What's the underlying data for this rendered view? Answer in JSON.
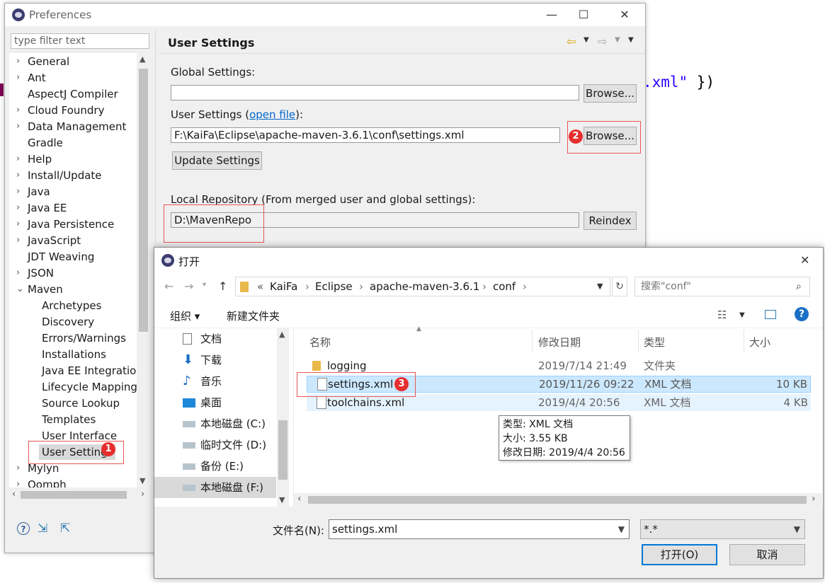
{
  "background_editor": {
    "code_fragment": "t.xml\" })"
  },
  "preferences": {
    "title": "Preferences",
    "filter_placeholder": "type filter text",
    "tree": [
      {
        "label": "General",
        "expandable": true
      },
      {
        "label": "Ant",
        "expandable": true
      },
      {
        "label": "AspectJ Compiler",
        "expandable": false
      },
      {
        "label": "Cloud Foundry",
        "expandable": true
      },
      {
        "label": "Data Management",
        "expandable": true
      },
      {
        "label": "Gradle",
        "expandable": false
      },
      {
        "label": "Help",
        "expandable": true
      },
      {
        "label": "Install/Update",
        "expandable": true
      },
      {
        "label": "Java",
        "expandable": true
      },
      {
        "label": "Java EE",
        "expandable": true
      },
      {
        "label": "Java Persistence",
        "expandable": true
      },
      {
        "label": "JavaScript",
        "expandable": true
      },
      {
        "label": "JDT Weaving",
        "expandable": false
      },
      {
        "label": "JSON",
        "expandable": true
      },
      {
        "label": "Maven",
        "expanded": true
      },
      {
        "label": "Archetypes",
        "child": true
      },
      {
        "label": "Discovery",
        "child": true
      },
      {
        "label": "Errors/Warnings",
        "child": true
      },
      {
        "label": "Installations",
        "child": true
      },
      {
        "label": "Java EE Integration",
        "child": true
      },
      {
        "label": "Lifecycle Mapping",
        "child": true
      },
      {
        "label": "Source Lookup",
        "child": true
      },
      {
        "label": "Templates",
        "child": true
      },
      {
        "label": "User Interface",
        "child": true
      },
      {
        "label": "User Settings",
        "child": true,
        "selected": true
      },
      {
        "label": "Mylyn",
        "expandable": true
      },
      {
        "label": "Oomph",
        "expandable": true
      }
    ],
    "page_title": "User Settings",
    "global_settings_label": "Global Settings:",
    "global_settings_value": "",
    "user_settings_label_prefix": "User Settings (",
    "user_settings_link": "open file",
    "user_settings_label_suffix": "):",
    "user_settings_value": "F:\\KaiFa\\Eclipse\\apache-maven-3.6.1\\conf\\settings.xml",
    "browse_label": "Browse...",
    "update_settings_label": "Update Settings",
    "local_repo_label": "Local Repository (From merged user and global settings):",
    "local_repo_value": "D:\\MavenRepo",
    "reindex_label": "Reindex",
    "badges": [
      "1",
      "2",
      "3"
    ]
  },
  "open_dialog": {
    "title": "打开",
    "breadcrumb": [
      "«",
      "KaiFa",
      "Eclipse",
      "apache-maven-3.6.1",
      "conf"
    ],
    "search_placeholder": "搜索\"conf\"",
    "organize_label": "组织 ▾",
    "new_folder_label": "新建文件夹",
    "nav_items": [
      "文档",
      "下载",
      "音乐",
      "桌面",
      "本地磁盘 (C:)",
      "临时文件 (D:)",
      "备份 (E:)",
      "本地磁盘 (F:)"
    ],
    "columns": {
      "name": "名称",
      "modified": "修改日期",
      "type": "类型",
      "size": "大小"
    },
    "files": [
      {
        "name": "logging",
        "modified": "2019/7/14 21:49",
        "type": "文件夹",
        "size": "",
        "kind": "folder"
      },
      {
        "name": "settings.xml",
        "modified": "2019/11/26 09:22",
        "type": "XML 文档",
        "size": "10 KB",
        "kind": "file",
        "selected": true
      },
      {
        "name": "toolchains.xml",
        "modified": "2019/4/4 20:56",
        "type": "XML 文档",
        "size": "4 KB",
        "kind": "file"
      }
    ],
    "tooltip": {
      "type": "类型: XML 文档",
      "size": "大小: 3.55 KB",
      "modified": "修改日期: 2019/4/4 20:56"
    },
    "filename_label": "文件名(N):",
    "filename_value": "settings.xml",
    "filter_value": "*.*",
    "open_label": "打开(O)",
    "cancel_label": "取消"
  },
  "colors": {
    "accent": "#0078d7",
    "badge": "#e62e2e",
    "highlight_box": "#e85656",
    "selection": "#cce8ff"
  }
}
